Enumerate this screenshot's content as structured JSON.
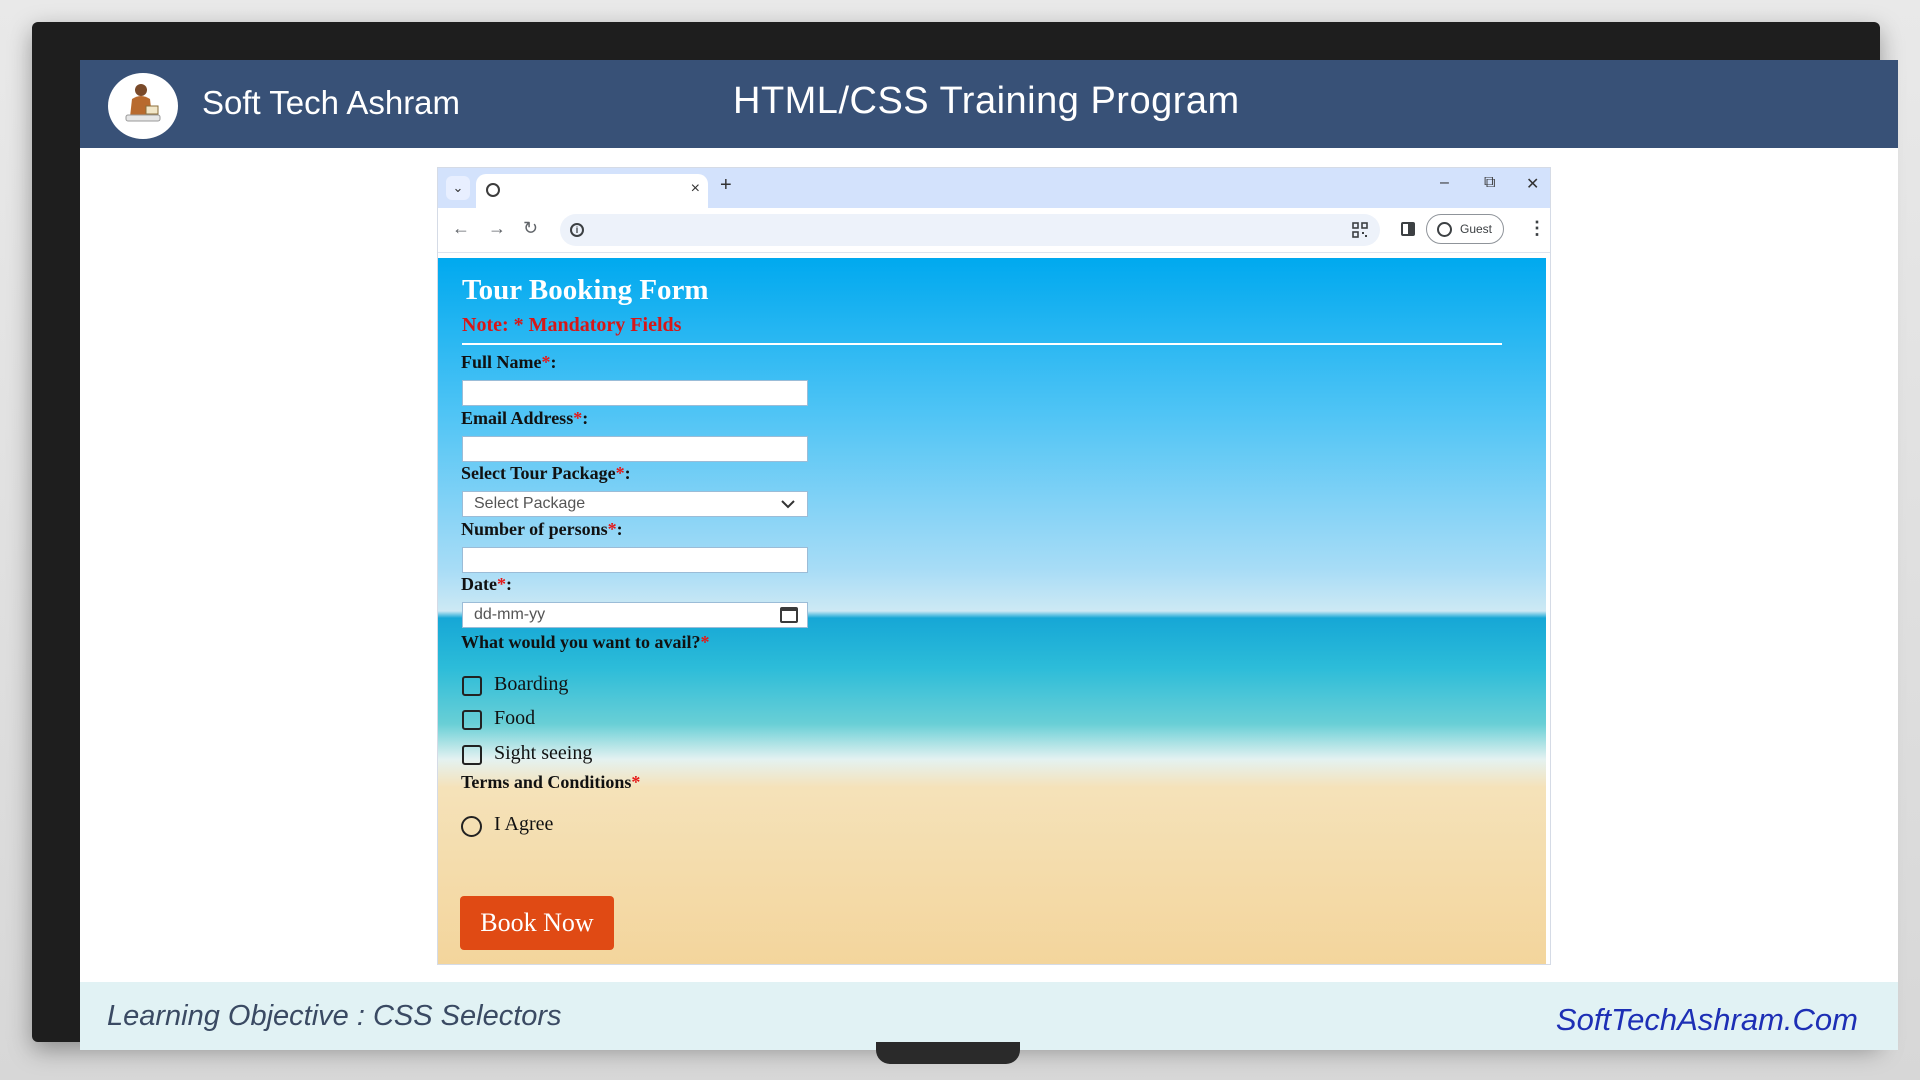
{
  "header": {
    "brand": "Soft Tech Ashram",
    "program_title": "HTML/CSS Training Program"
  },
  "footer": {
    "objective": "Learning Objective :  CSS Selectors",
    "site": "SoftTechAshram.Com"
  },
  "browser": {
    "tab_close": "×",
    "new_tab": "+",
    "minimize": "–",
    "restore": "⧉",
    "close": "✕",
    "back": "←",
    "forward": "→",
    "reload": "↻",
    "guest_label": "Guest",
    "menu": "⋮",
    "tab_dropdown": "⌄"
  },
  "form": {
    "title": "Tour Booking Form",
    "note": "Note: * Mandatory Fields",
    "required_mark": "*",
    "colon": ":",
    "full_name_label": "Full Name",
    "email_label": "Email Address",
    "package_label": "Select Tour Package",
    "package_placeholder": "Select Package",
    "persons_label": "Number of persons",
    "date_label": "Date",
    "date_placeholder": "dd-mm-yy",
    "avail_label": "What would you want to avail?",
    "options": [
      "Boarding",
      "Food",
      "Sight seeing"
    ],
    "terms_label": "Terms and Conditions",
    "agree_label": "I Agree",
    "submit": "Book Now"
  },
  "icons": {
    "logo": "sage-reading-logo",
    "globe": "globe-icon",
    "info": "info-icon",
    "qr": "qr-code-icon",
    "side_panel": "side-panel-icon",
    "guest": "account-icon",
    "calendar": "calendar-icon",
    "chevron": "chevron-down-icon"
  },
  "colors": {
    "header_bg": "#385177",
    "footer_bg": "#e1f2f4",
    "note_red": "#d81717",
    "button_orange": "#e04a14",
    "link_blue": "#1d2fb5"
  }
}
